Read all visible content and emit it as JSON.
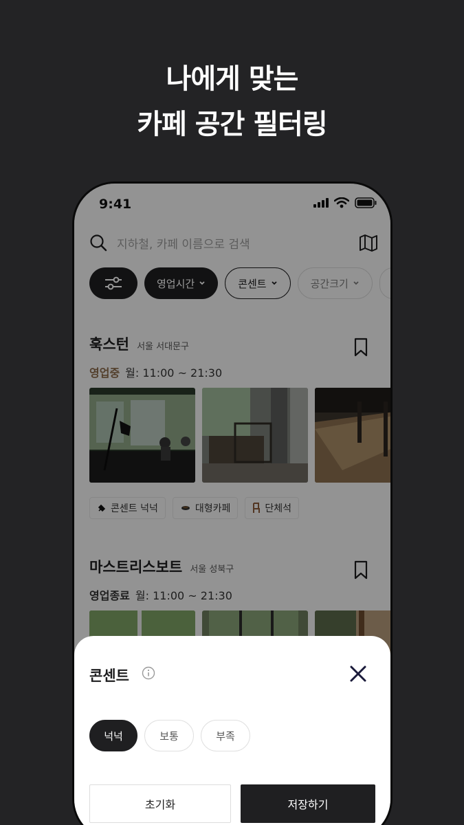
{
  "headline": {
    "line1": "나에게 맞는",
    "line2": "카페 공간 필터링"
  },
  "status_bar": {
    "time": "9:41"
  },
  "search": {
    "placeholder": "지하철, 카페 이름으로 검색"
  },
  "filters": [
    {
      "label": "영업시간",
      "style": "dark"
    },
    {
      "label": "콘센트",
      "style": "outline"
    },
    {
      "label": "공간크기",
      "style": "light"
    }
  ],
  "cafes": [
    {
      "name": "훅스턴",
      "location": "서울 서대문구",
      "status": "영업중",
      "hours": "월: 11:00 ~ 21:30",
      "tags": [
        "콘센트 넉넉",
        "대형카페",
        "단체석"
      ]
    },
    {
      "name": "마스트리스보트",
      "location": "서울 성북구",
      "status": "영업종료",
      "hours": "월: 11:00 ~ 21:30"
    }
  ],
  "sheet": {
    "title": "콘센트",
    "options": [
      "넉넉",
      "보통",
      "부족"
    ],
    "selected": "넉넉",
    "reset_label": "초기화",
    "save_label": "저장하기"
  },
  "colors": {
    "accent_open": "#8a6a4a",
    "dark": "#1f1f21",
    "background": "#232325"
  }
}
